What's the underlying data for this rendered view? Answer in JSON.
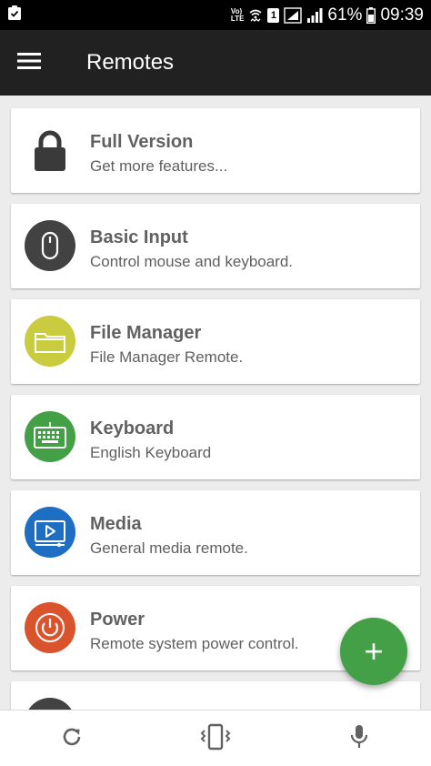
{
  "status_bar": {
    "battery_percent": "61%",
    "time": "09:39",
    "network_label_top": "Vo)",
    "network_label_bottom": "LTE",
    "sim_label": "1"
  },
  "app_bar": {
    "title": "Remotes",
    "menu_icon": "hamburger-menu-icon"
  },
  "remotes": [
    {
      "title": "Full Version",
      "subtitle": "Get more features...",
      "icon": "lock-icon",
      "color": "#3a3a3a"
    },
    {
      "title": "Basic Input",
      "subtitle": "Control mouse and keyboard.",
      "icon": "mouse-icon",
      "color": "#424242"
    },
    {
      "title": "File Manager",
      "subtitle": "File Manager Remote.",
      "icon": "folder-icon",
      "color": "#c9cc3f"
    },
    {
      "title": "Keyboard",
      "subtitle": "English Keyboard",
      "icon": "keyboard-icon",
      "color": "#43a047"
    },
    {
      "title": "Media",
      "subtitle": "General media remote.",
      "icon": "media-player-icon",
      "color": "#1e6fc3"
    },
    {
      "title": "Power",
      "subtitle": "Remote system power control.",
      "icon": "power-icon",
      "color": "#d9532c"
    },
    {
      "title": "",
      "subtitle": "",
      "icon": "partial-item-icon",
      "color": "#424242"
    }
  ],
  "fab": {
    "label": "+",
    "icon": "add-icon",
    "color": "#43a047"
  },
  "bottom_nav": [
    {
      "icon": "refresh-icon"
    },
    {
      "icon": "phone-vibrate-icon"
    },
    {
      "icon": "microphone-icon"
    }
  ]
}
